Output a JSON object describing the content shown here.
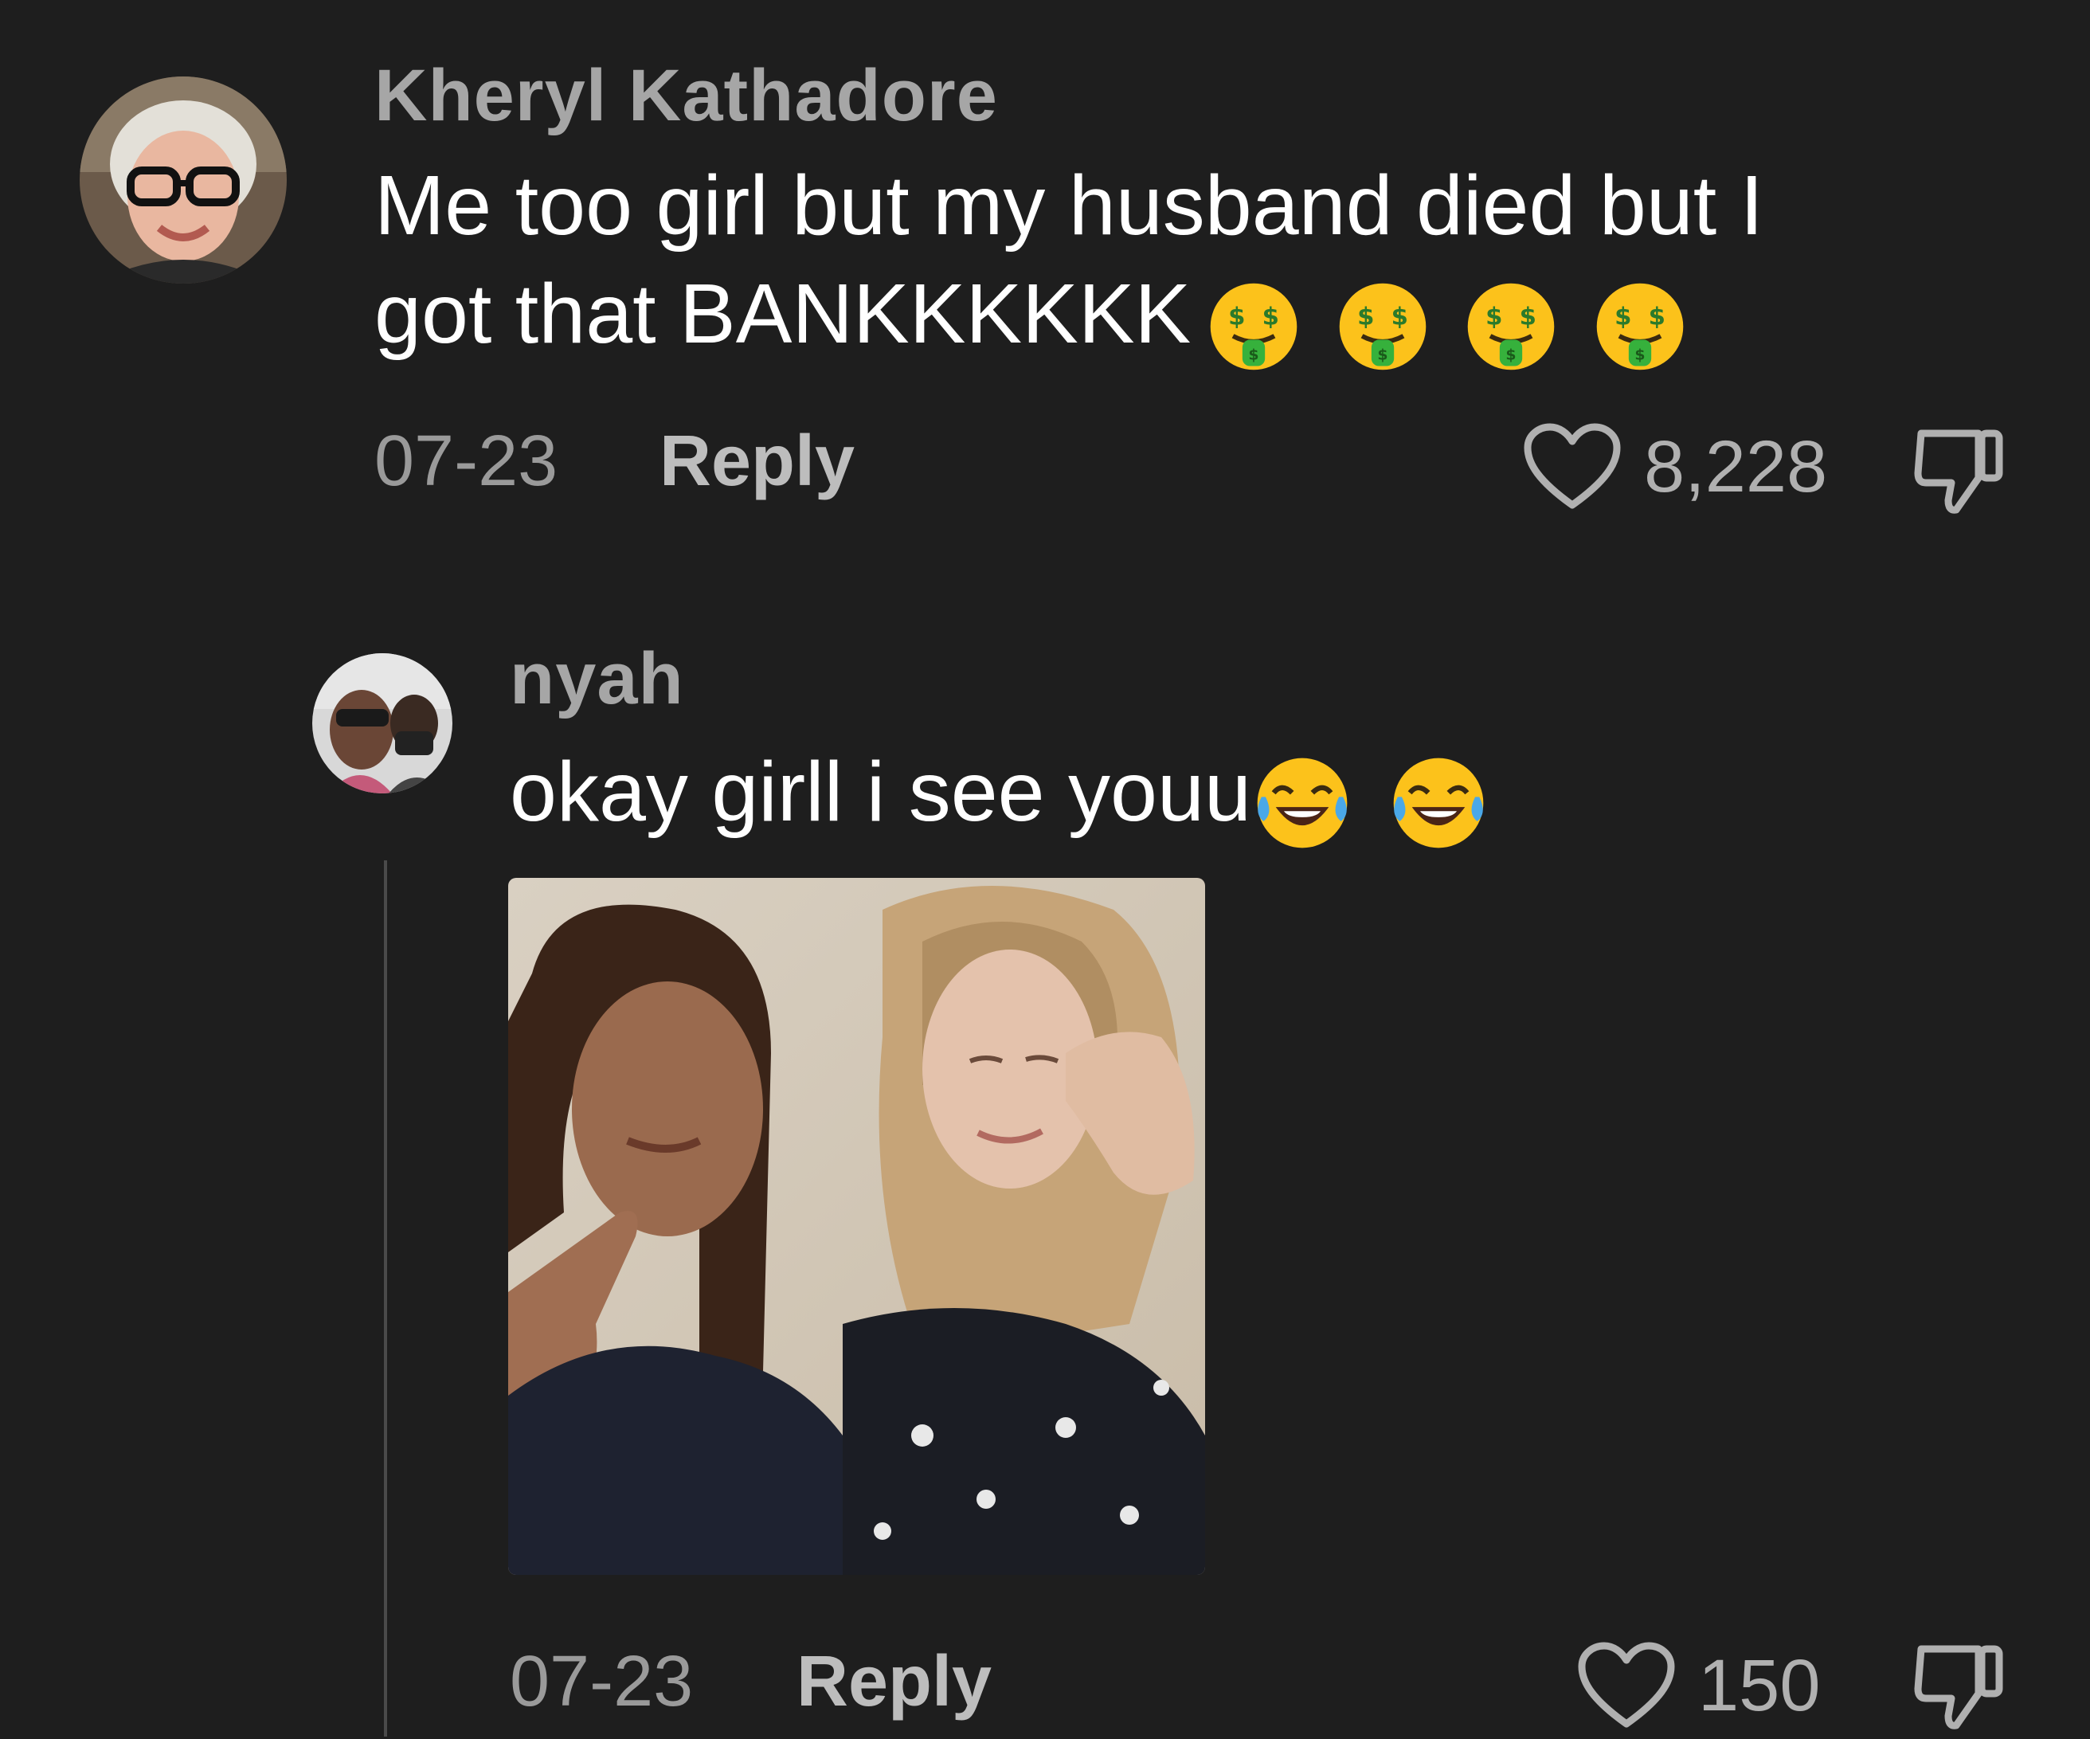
{
  "comments": [
    {
      "username": "Kheryl Kathadore",
      "text_line1": "Me too girl but my husband died but I",
      "text_line2": "got that BANKKKKKK",
      "emojis": [
        "money-mouth-face",
        "money-mouth-face",
        "money-mouth-face",
        "money-mouth-face"
      ],
      "date": "07-23",
      "reply_label": "Reply",
      "likes": "8,228"
    }
  ],
  "replies": [
    {
      "username": "nyah",
      "text": "okay girll i see youu",
      "emojis": [
        "face-with-tears-of-joy",
        "face-with-tears-of-joy"
      ],
      "attachment": "photo",
      "date": "07-23",
      "reply_label": "Reply",
      "likes": "150"
    }
  ],
  "colors": {
    "background": "#1e1e1e",
    "username": "#a6a6a6",
    "text": "#ffffff",
    "meta": "#9a9a9a"
  }
}
